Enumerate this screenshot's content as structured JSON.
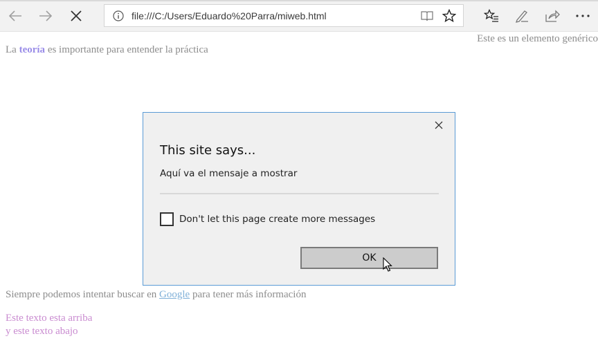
{
  "browser": {
    "url": "file:///C:/Users/Eduardo%20Parra/miweb.html",
    "icons": {
      "back": "back-arrow-icon",
      "forward": "forward-arrow-icon",
      "stop": "close-icon",
      "info": "info-icon",
      "reading_view": "reading-view-icon",
      "favorite": "star-icon",
      "favorites_hub": "favorites-hub-icon",
      "notes": "pen-icon",
      "share": "share-icon",
      "more": "more-icon"
    }
  },
  "page": {
    "top_right_text": "Este es un elemento genérico",
    "line1_prefix": "La ",
    "line1_bold": "teoría",
    "line1_suffix": " es importante para entender la práctica",
    "line2_prefix": "Siempre podemos intentar buscar en ",
    "line2_link": "Google",
    "line2_suffix": " para tener más información",
    "line3": "Este texto esta arriba",
    "line4": "y este texto abajo"
  },
  "dialog": {
    "title": "This site says...",
    "message": "Aquí va el mensaje a mostrar",
    "checkbox_label": "Don't let this page create more messages",
    "checkbox_checked": false,
    "ok_label": "OK"
  },
  "colors": {
    "bold_text": "#9a8de8",
    "link": "#7fb0d8",
    "pink_text": "#c98bd0",
    "dialog_border": "#5a9bd5"
  }
}
